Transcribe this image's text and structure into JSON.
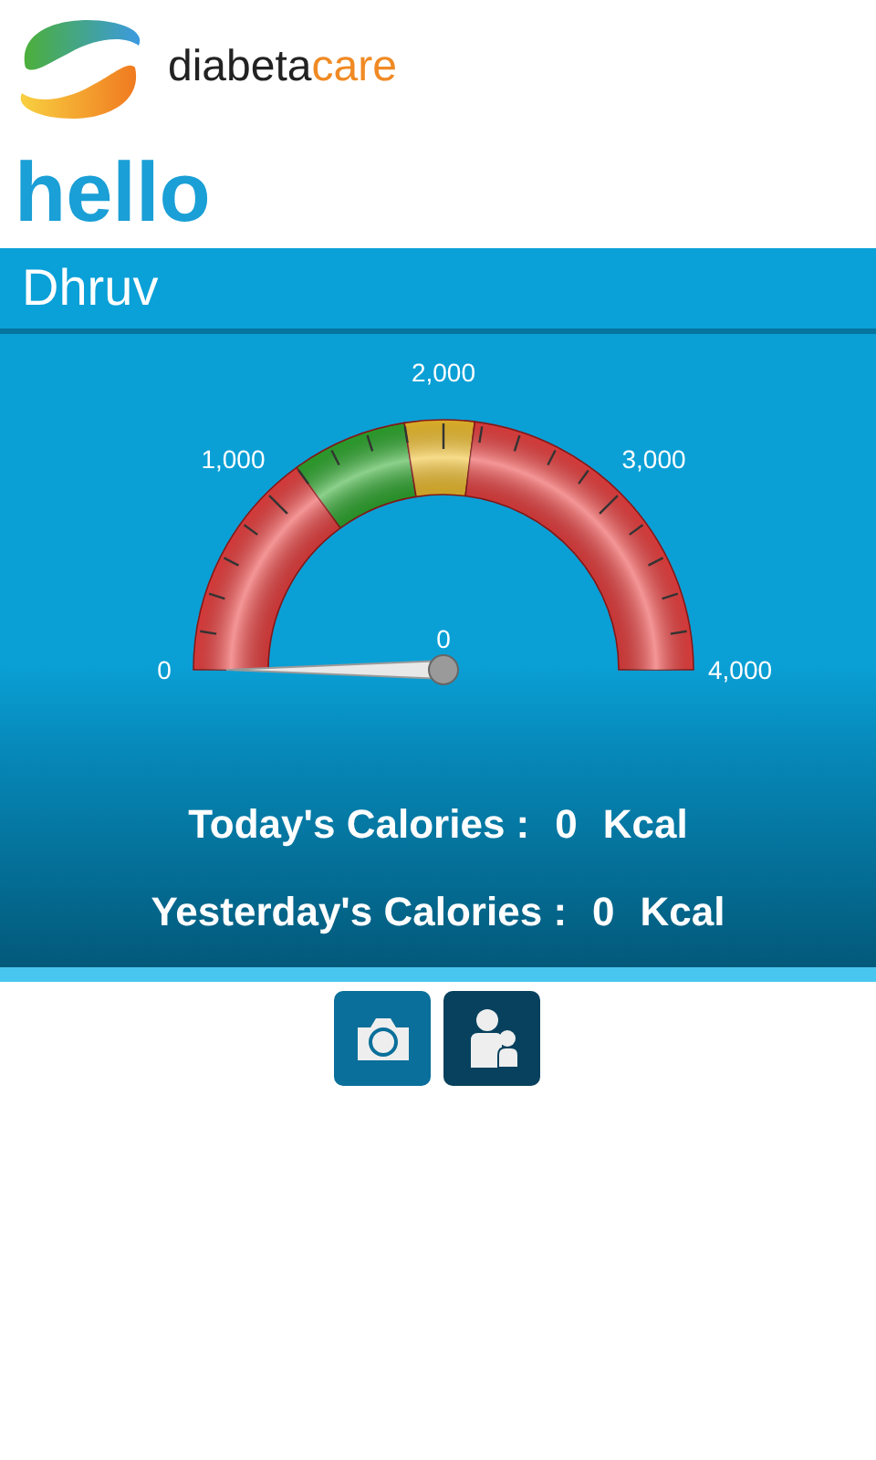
{
  "logo": {
    "brand_main": "diabeta",
    "brand_accent": "care"
  },
  "greeting": "hello",
  "user_name": "Dhruv",
  "gauge": {
    "tick_labels": [
      "0",
      "1,000",
      "2,000",
      "3,000",
      "4,000"
    ],
    "value_label": "0"
  },
  "stats": [
    {
      "label": "Today's Calories :",
      "value": "0",
      "unit": "Kcal"
    },
    {
      "label": "Yesterday's Calories :",
      "value": "0",
      "unit": "Kcal"
    }
  ],
  "actions": [
    {
      "kind": "camera"
    },
    {
      "kind": "family"
    }
  ]
}
